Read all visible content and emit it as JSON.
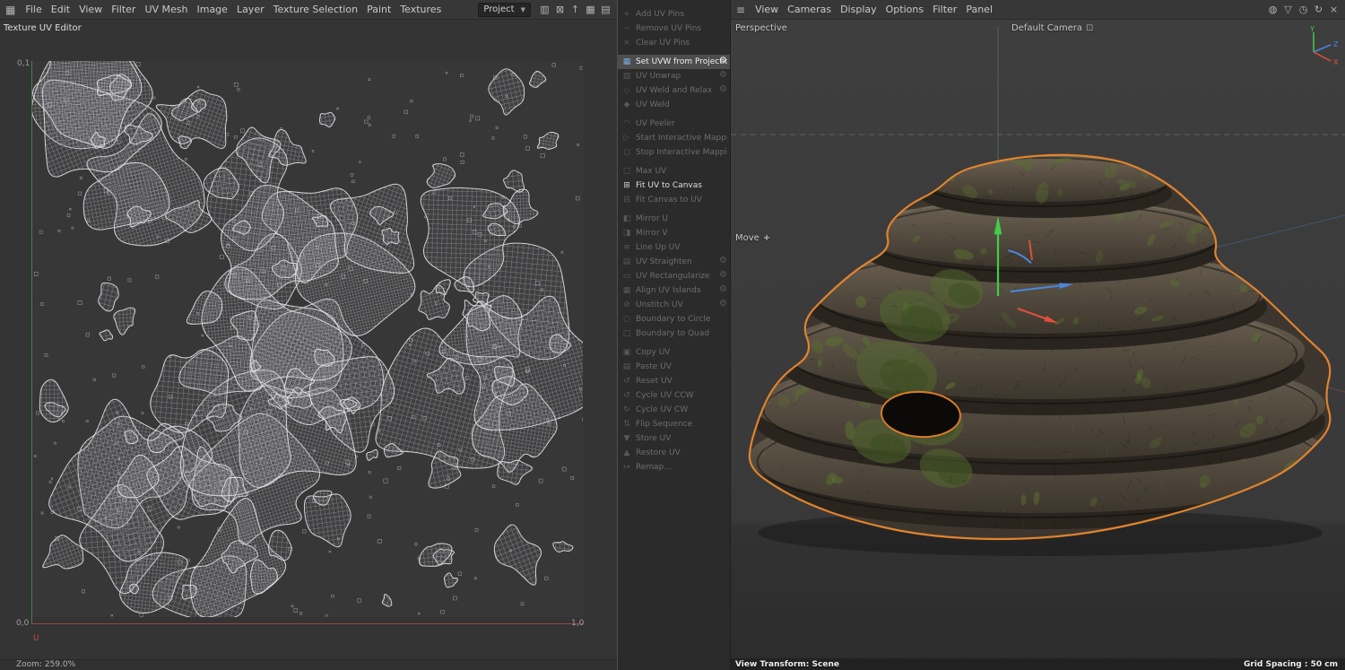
{
  "colors": {
    "accent_orange": "#e0832f",
    "axis_green": "#3fcf46",
    "axis_red": "#e0503c",
    "axis_blue": "#4a86e0"
  },
  "left_panel": {
    "leading_icon_glyph": "▦",
    "menu": [
      "File",
      "Edit",
      "View",
      "Filter",
      "UV Mesh",
      "Image",
      "Layer",
      "Texture Selection",
      "Paint",
      "Textures"
    ],
    "project_dropdown": {
      "value": "Project"
    },
    "toolbar_icons": [
      {
        "name": "histogram-icon",
        "glyph": "▥"
      },
      {
        "name": "lock-icon",
        "glyph": "⊠"
      },
      {
        "name": "arrow-up-icon",
        "glyph": "↑"
      },
      {
        "name": "grid-icon",
        "glyph": "▦"
      },
      {
        "name": "layout-icon",
        "glyph": "▤"
      }
    ],
    "title": "Texture UV Editor",
    "uv_view": {
      "coord_top_left": "0,1",
      "coord_bottom_left": "0,0",
      "coord_bottom_right": "1,0",
      "u_label": "U"
    },
    "status": "Zoom: 259.0%"
  },
  "commands_panel": {
    "groups": [
      [
        {
          "label": "Add UV Pins",
          "icon": "pin-add-icon",
          "glyph": "+",
          "enabled": false,
          "active": false,
          "gear": false
        },
        {
          "label": "Remove UV Pins",
          "icon": "pin-remove-icon",
          "glyph": "−",
          "enabled": false,
          "active": false,
          "gear": false
        },
        {
          "label": "Clear UV Pins",
          "icon": "pin-clear-icon",
          "glyph": "×",
          "enabled": false,
          "active": false,
          "gear": false
        }
      ],
      [
        {
          "label": "Set UVW from Projection",
          "icon": "set-uvw-projection-icon",
          "glyph": "▦",
          "enabled": true,
          "active": true,
          "gear": true
        },
        {
          "label": "UV Unwrap",
          "icon": "uv-unwrap-icon",
          "glyph": "▨",
          "enabled": false,
          "active": false,
          "gear": true
        },
        {
          "label": "UV Weld and Relax",
          "icon": "uv-weld-relax-icon",
          "glyph": "◇",
          "enabled": false,
          "active": false,
          "gear": true
        },
        {
          "label": "UV Weld",
          "icon": "uv-weld-icon",
          "glyph": "◆",
          "enabled": false,
          "active": false,
          "gear": false
        }
      ],
      [
        {
          "label": "UV Peeler",
          "icon": "uv-peeler-icon",
          "glyph": "◠",
          "enabled": false,
          "active": false,
          "gear": false
        },
        {
          "label": "Start Interactive Mapping",
          "icon": "start-interactive-mapping-icon",
          "glyph": "▷",
          "enabled": false,
          "active": false,
          "gear": false
        },
        {
          "label": "Stop Interactive Mapping",
          "icon": "stop-interactive-mapping-icon",
          "glyph": "◻",
          "enabled": false,
          "active": false,
          "gear": false
        }
      ],
      [
        {
          "label": "Max UV",
          "icon": "max-uv-icon",
          "glyph": "▢",
          "enabled": false,
          "active": false,
          "gear": false
        },
        {
          "label": "Fit UV to Canvas",
          "icon": "fit-uv-to-canvas-icon",
          "glyph": "⊞",
          "enabled": true,
          "active": false,
          "gear": false
        },
        {
          "label": "Fit Canvas to UV",
          "icon": "fit-canvas-to-uv-icon",
          "glyph": "⊟",
          "enabled": false,
          "active": false,
          "gear": false
        }
      ],
      [
        {
          "label": "Mirror U",
          "icon": "mirror-u-icon",
          "glyph": "◧",
          "enabled": false,
          "active": false,
          "gear": false
        },
        {
          "label": "Mirror V",
          "icon": "mirror-v-icon",
          "glyph": "◨",
          "enabled": false,
          "active": false,
          "gear": false
        },
        {
          "label": "Line Up UV",
          "icon": "line-up-uv-icon",
          "glyph": "≡",
          "enabled": false,
          "active": false,
          "gear": false
        },
        {
          "label": "UV Straighten",
          "icon": "uv-straighten-icon",
          "glyph": "▤",
          "enabled": false,
          "active": false,
          "gear": true
        },
        {
          "label": "UV Rectangularize",
          "icon": "uv-rectangularize-icon",
          "glyph": "▭",
          "enabled": false,
          "active": false,
          "gear": true
        },
        {
          "label": "Align UV Islands",
          "icon": "align-uv-islands-icon",
          "glyph": "▦",
          "enabled": false,
          "active": false,
          "gear": true
        },
        {
          "label": "Unstitch UV",
          "icon": "unstitch-uv-icon",
          "glyph": "⊘",
          "enabled": false,
          "active": false,
          "gear": true
        },
        {
          "label": "Boundary to Circle",
          "icon": "boundary-to-circle-icon",
          "glyph": "○",
          "enabled": false,
          "active": false,
          "gear": false
        },
        {
          "label": "Boundary to Quad",
          "icon": "boundary-to-quad-icon",
          "glyph": "□",
          "enabled": false,
          "active": false,
          "gear": false
        }
      ],
      [
        {
          "label": "Copy UV",
          "icon": "copy-uv-icon",
          "glyph": "▣",
          "enabled": false,
          "active": false,
          "gear": false
        },
        {
          "label": "Paste UV",
          "icon": "paste-uv-icon",
          "glyph": "▤",
          "enabled": false,
          "active": false,
          "gear": false
        },
        {
          "label": "Reset UV",
          "icon": "reset-uv-icon",
          "glyph": "↺",
          "enabled": false,
          "active": false,
          "gear": false
        },
        {
          "label": "Cycle UV CCW",
          "icon": "cycle-uv-ccw-icon",
          "glyph": "↺",
          "enabled": false,
          "active": false,
          "gear": false
        },
        {
          "label": "Cycle UV CW",
          "icon": "cycle-uv-cw-icon",
          "glyph": "↻",
          "enabled": false,
          "active": false,
          "gear": false
        },
        {
          "label": "Flip Sequence",
          "icon": "flip-sequence-icon",
          "glyph": "⇅",
          "enabled": false,
          "active": false,
          "gear": false
        },
        {
          "label": "Store UV",
          "icon": "store-uv-icon",
          "glyph": "▼",
          "enabled": false,
          "active": false,
          "gear": false
        },
        {
          "label": "Restore UV",
          "icon": "restore-uv-icon",
          "glyph": "▲",
          "enabled": false,
          "active": false,
          "gear": false
        },
        {
          "label": "Remap...",
          "icon": "remap-icon",
          "glyph": "↦",
          "enabled": false,
          "active": false,
          "gear": false
        }
      ]
    ]
  },
  "viewport_panel": {
    "leading_icon_glyph": "≡",
    "menu": [
      "View",
      "Cameras",
      "Display",
      "Options",
      "Filter",
      "Panel"
    ],
    "toolbar_icons": [
      {
        "name": "globe-icon",
        "glyph": "◍"
      },
      {
        "name": "filter-icon",
        "glyph": "▽"
      },
      {
        "name": "history-icon",
        "glyph": "◷"
      },
      {
        "name": "refresh-icon",
        "glyph": "↻"
      },
      {
        "name": "close-icon",
        "glyph": "×"
      }
    ],
    "view_label": "Perspective",
    "camera_label": "Default Camera",
    "camera_icon_glyph": "⊡",
    "tool_label": "Move",
    "tool_icon_glyph": "+",
    "status_left": "View Transform: Scene",
    "status_right": "Grid Spacing : 50 cm",
    "axis_labels": {
      "x": "X",
      "y": "Y",
      "z": "Z"
    }
  }
}
